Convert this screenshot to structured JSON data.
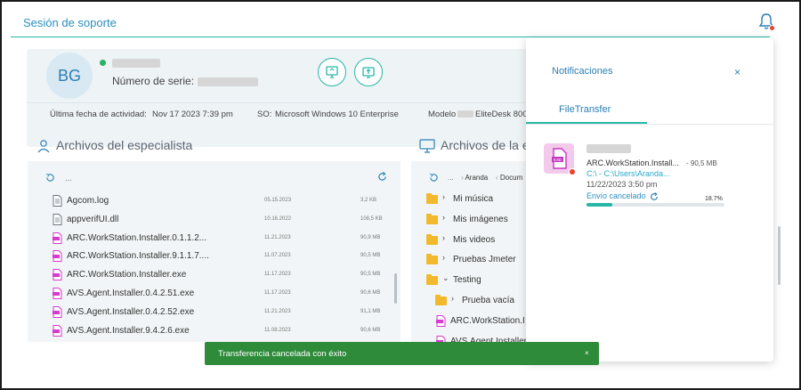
{
  "header": {
    "title": "Sesión de soporte"
  },
  "user": {
    "initials": "BG",
    "serial_label": "Número de serie:"
  },
  "info": {
    "activity_label": "Última fecha de actividad:",
    "activity_value": "Nov 17 2023 7:39 pm",
    "os_label": "SO:",
    "os_value": "Microsoft Windows 10 Enterprise",
    "model_label": "Modelo",
    "model_value": "EliteDesk 800"
  },
  "specialist": {
    "title": "Archivos del especialista",
    "path": "...",
    "files": [
      {
        "name": "Agcom.log",
        "date": "05.15.2023",
        "size": "3,2 KB",
        "type": "doc"
      },
      {
        "name": "appverifUI.dll",
        "date": "10.16.2022",
        "size": "108,5 KB",
        "type": "doc"
      },
      {
        "name": "ARC.WorkStation.Installer.0.1.1.2...",
        "date": "11.21.2023",
        "size": "90,9 MB",
        "type": "exe"
      },
      {
        "name": "ARC.WorkStation.Installer.9.1.1.7....",
        "date": "11.07.2023",
        "size": "90,5 MB",
        "type": "exe"
      },
      {
        "name": "ARC.WorkStation.Installer.exe",
        "date": "11.17.2023",
        "size": "90,5 MB",
        "type": "exe"
      },
      {
        "name": "AVS.Agent.Installer.0.4.2.51.exe",
        "date": "11.17.2023",
        "size": "90,6 MB",
        "type": "exe"
      },
      {
        "name": "AVS.Agent.Installer.0.4.2.52.exe",
        "date": "11.21.2023",
        "size": "91,1 MB",
        "type": "exe"
      },
      {
        "name": "AVS.Agent.Installer.9.4.2.6.exe",
        "date": "11.08.2023",
        "size": "90,6 MB",
        "type": "exe"
      }
    ]
  },
  "remote": {
    "title": "Archivos de la e",
    "path_dots": "...",
    "path_1": "Aranda",
    "path_2": "Docum",
    "items": [
      {
        "name": "Mi música",
        "kind": "folder",
        "chev": "›"
      },
      {
        "name": "Mis imágenes",
        "kind": "folder",
        "chev": "›"
      },
      {
        "name": "Mis videos",
        "kind": "folder",
        "chev": "›"
      },
      {
        "name": "Pruebas Jmeter",
        "kind": "folder",
        "chev": "›"
      },
      {
        "name": "Testing",
        "kind": "folder",
        "chev": "⌄"
      },
      {
        "name": "Prueba vacía",
        "kind": "subfolder",
        "chev": "›"
      },
      {
        "name": "ARC.WorkStation.I",
        "kind": "exe"
      },
      {
        "name": "AVS.Agent.Installer",
        "kind": "exe"
      }
    ]
  },
  "notifications": {
    "title": "Notificaciones",
    "close": "×",
    "tab": "FileTransfer",
    "item": {
      "file_name": "ARC.WorkStation.Install...",
      "file_size": "- 90,5 MB",
      "path": "C:\\ - C:\\Users\\Aranda...",
      "date": "11/22/2023 3:50 pm",
      "status": "Envío cancelado",
      "percent_label": "18.7%",
      "progress": 0.187
    }
  },
  "toast": {
    "message": "Transferencia cancelada con éxito",
    "close": "×"
  },
  "colors": {
    "accent": "#27b7a6",
    "link": "#2a7fb3",
    "toast": "#2e8b3a",
    "exe": "#d63ad0",
    "folder": "#f2b92c"
  }
}
